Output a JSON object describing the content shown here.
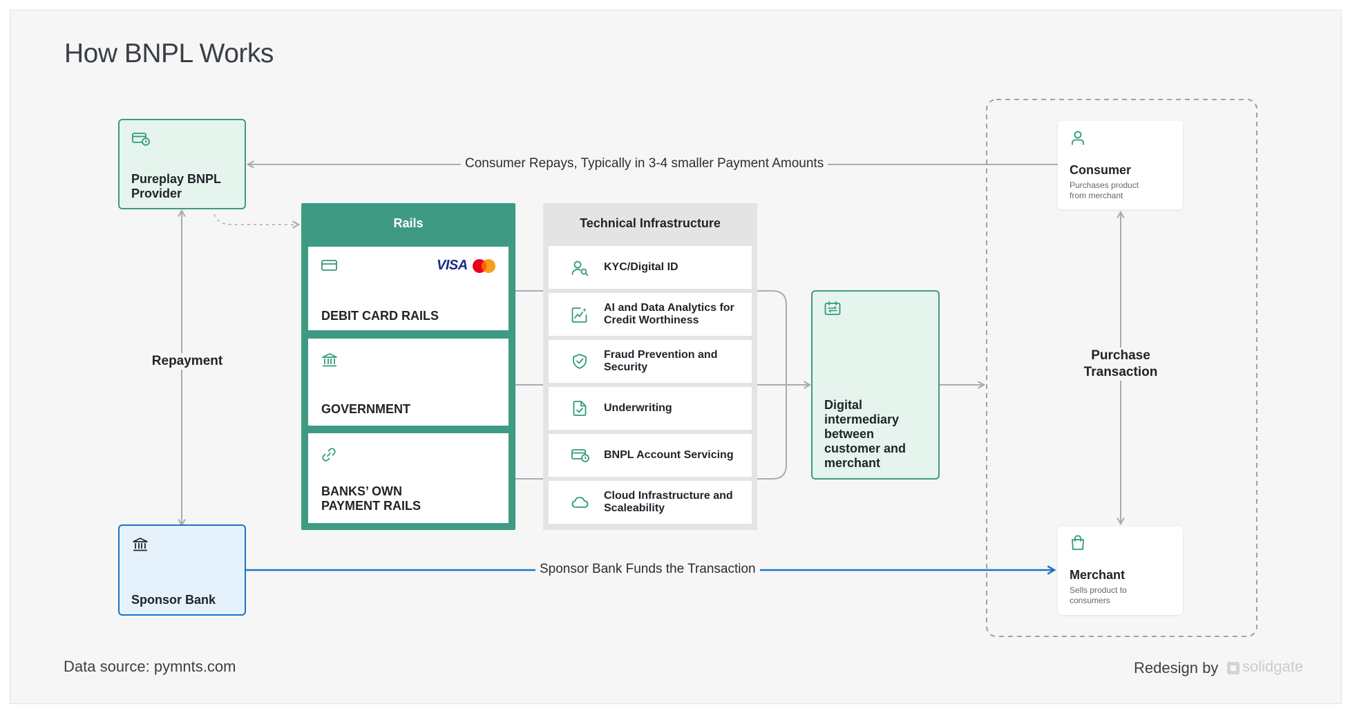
{
  "title": "How BNPL Works",
  "provider": {
    "label": "Pureplay BNPL Provider",
    "icon": "card-clock-icon"
  },
  "sponsor_bank": {
    "label": "Sponsor Bank",
    "icon": "bank-icon"
  },
  "consumer": {
    "label": "Consumer",
    "description": "Purchases product from merchant",
    "icon": "user-icon"
  },
  "merchant": {
    "label": "Merchant",
    "description": "Sells product to consumers",
    "icon": "shopping-bag-icon"
  },
  "rails": {
    "header": "Rails",
    "items": [
      {
        "label": "DEBIT CARD RAILS",
        "icon": "credit-card-icon",
        "brand": "VISA"
      },
      {
        "label": "GOVERNMENT",
        "icon": "government-building-icon"
      },
      {
        "label": "BANKS’ OWN PAYMENT RAILS",
        "icon": "link-icon"
      }
    ]
  },
  "technical_infrastructure": {
    "header": "Technical Infrastructure",
    "items": [
      {
        "label": "KYC/Digital ID",
        "icon": "user-search-icon"
      },
      {
        "label": "AI and Data Analytics for Credit Worthiness",
        "icon": "analytics-icon"
      },
      {
        "label": "Fraud Prevention and Security",
        "icon": "shield-check-icon"
      },
      {
        "label": "Underwriting",
        "icon": "document-check-icon"
      },
      {
        "label": "BNPL Account Servicing",
        "icon": "card-clock-icon"
      },
      {
        "label": "Cloud Infrastructure and Scaleability",
        "icon": "cloud-icon"
      }
    ]
  },
  "intermediary": {
    "label": "Digital intermediary between customer and merchant",
    "icon": "exchange-icon"
  },
  "edges": {
    "consumer_repays": "Consumer Repays, Typically in 3-4 smaller Payment Amounts",
    "repayment": "Repayment",
    "sponsor_funds": "Sponsor Bank Funds the Transaction",
    "purchase_transaction": "Purchase Transaction"
  },
  "footer": {
    "source": "Data source: pymnts.com",
    "credit": "Redesign by",
    "brand": "solidgate"
  },
  "colors": {
    "green": "#3e9a82",
    "blue": "#1c73c4",
    "arrow_gray": "#a7abb3"
  }
}
